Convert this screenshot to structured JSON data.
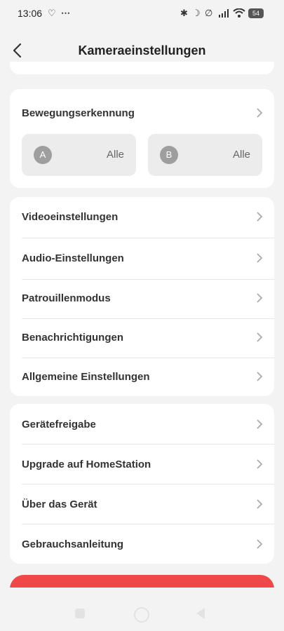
{
  "status_bar": {
    "time": "13:06",
    "battery": "54",
    "icons": [
      "sync-icon",
      "more-icon",
      "bluetooth-icon",
      "moon-icon",
      "mute-icon",
      "signal-icon",
      "wifi-icon",
      "battery-icon"
    ]
  },
  "header": {
    "title": "Kameraeinstellungen"
  },
  "motion": {
    "label": "Bewegungserkennung",
    "zones": [
      {
        "badge": "A",
        "value": "Alle"
      },
      {
        "badge": "B",
        "value": "Alle"
      }
    ]
  },
  "settings": {
    "items": [
      {
        "label": "Videoeinstellungen"
      },
      {
        "label": "Audio-Einstellungen"
      },
      {
        "label": "Patrouillenmodus"
      },
      {
        "label": "Benachrichtigungen"
      },
      {
        "label": "Allgemeine Einstellungen"
      }
    ]
  },
  "device": {
    "items": [
      {
        "label": "Gerätefreigabe"
      },
      {
        "label": "Upgrade auf HomeStation"
      },
      {
        "label": "Über das Gerät"
      },
      {
        "label": "Gebrauchsanleitung"
      }
    ]
  },
  "colors": {
    "background": "#f3f3f3",
    "card": "#ffffff",
    "danger": "#f04848",
    "text": "#333333",
    "muted": "#666666"
  }
}
